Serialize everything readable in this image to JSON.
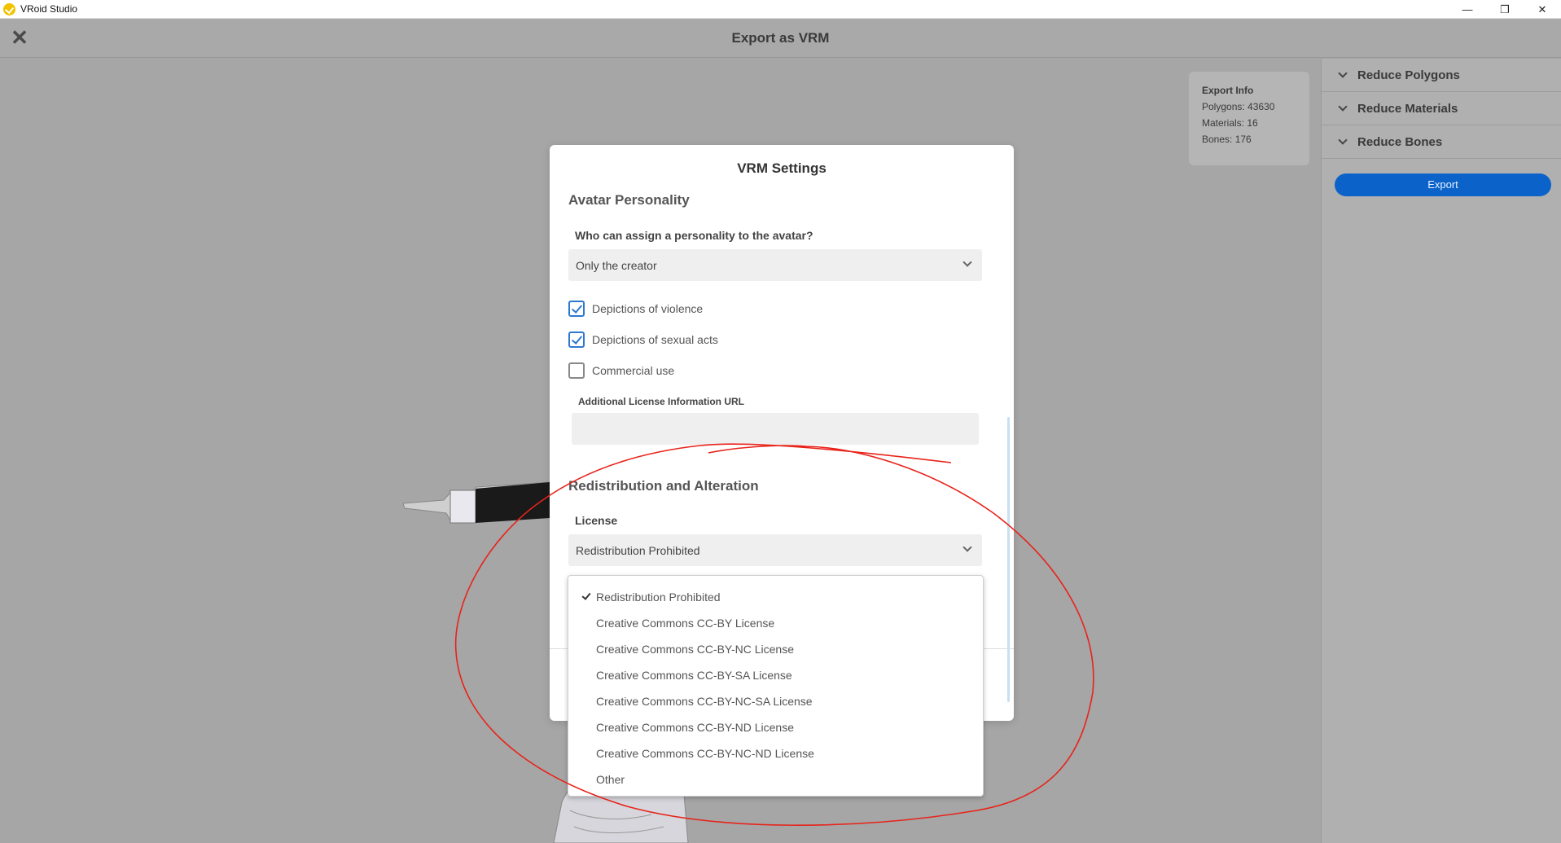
{
  "window": {
    "title": "VRoid Studio",
    "controls": {
      "minimize": "—",
      "maximize": "❐",
      "close": "✕"
    }
  },
  "header": {
    "close_glyph": "✕",
    "title": "Export as VRM"
  },
  "export_info": {
    "title": "Export Info",
    "polygons": "Polygons: 43630",
    "materials": "Materials: 16",
    "bones": "Bones: 176"
  },
  "right_panel": {
    "items": [
      {
        "label": "Reduce Polygons"
      },
      {
        "label": "Reduce Materials"
      },
      {
        "label": "Reduce Bones"
      }
    ],
    "export_label": "Export",
    "accent_color": "#0b63c9"
  },
  "dialog": {
    "title": "VRM Settings",
    "personality": {
      "section_title": "Avatar Personality",
      "question": "Who can assign a personality to the avatar?",
      "selected": "Only the creator"
    },
    "checkboxes": [
      {
        "label": "Depictions of violence",
        "checked": true
      },
      {
        "label": "Depictions of sexual acts",
        "checked": true
      },
      {
        "label": "Commercial use",
        "checked": false
      }
    ],
    "url_label": "Additional License Information URL",
    "url_value": "",
    "redistribution": {
      "section_title": "Redistribution and Alteration",
      "license_label": "License",
      "selected": "Redistribution Prohibited",
      "options": [
        "Redistribution Prohibited",
        "Creative Commons CC-BY License",
        "Creative Commons CC-BY-NC License",
        "Creative Commons CC-BY-SA License",
        "Creative Commons CC-BY-NC-SA License",
        "Creative Commons CC-BY-ND License",
        "Creative Commons CC-BY-NC-ND License",
        "Other"
      ]
    }
  },
  "annotation_color": "#e8231a"
}
